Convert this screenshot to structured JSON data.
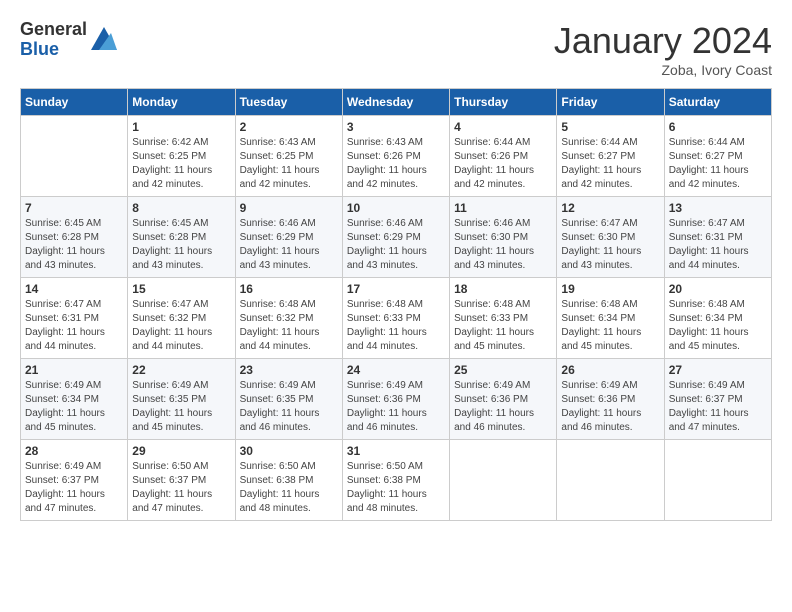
{
  "logo": {
    "general": "General",
    "blue": "Blue"
  },
  "title": "January 2024",
  "subtitle": "Zoba, Ivory Coast",
  "days_of_week": [
    "Sunday",
    "Monday",
    "Tuesday",
    "Wednesday",
    "Thursday",
    "Friday",
    "Saturday"
  ],
  "weeks": [
    [
      {
        "day": "",
        "info": ""
      },
      {
        "day": "1",
        "info": "Sunrise: 6:42 AM\nSunset: 6:25 PM\nDaylight: 11 hours\nand 42 minutes."
      },
      {
        "day": "2",
        "info": "Sunrise: 6:43 AM\nSunset: 6:25 PM\nDaylight: 11 hours\nand 42 minutes."
      },
      {
        "day": "3",
        "info": "Sunrise: 6:43 AM\nSunset: 6:26 PM\nDaylight: 11 hours\nand 42 minutes."
      },
      {
        "day": "4",
        "info": "Sunrise: 6:44 AM\nSunset: 6:26 PM\nDaylight: 11 hours\nand 42 minutes."
      },
      {
        "day": "5",
        "info": "Sunrise: 6:44 AM\nSunset: 6:27 PM\nDaylight: 11 hours\nand 42 minutes."
      },
      {
        "day": "6",
        "info": "Sunrise: 6:44 AM\nSunset: 6:27 PM\nDaylight: 11 hours\nand 42 minutes."
      }
    ],
    [
      {
        "day": "7",
        "info": "Sunrise: 6:45 AM\nSunset: 6:28 PM\nDaylight: 11 hours\nand 43 minutes."
      },
      {
        "day": "8",
        "info": "Sunrise: 6:45 AM\nSunset: 6:28 PM\nDaylight: 11 hours\nand 43 minutes."
      },
      {
        "day": "9",
        "info": "Sunrise: 6:46 AM\nSunset: 6:29 PM\nDaylight: 11 hours\nand 43 minutes."
      },
      {
        "day": "10",
        "info": "Sunrise: 6:46 AM\nSunset: 6:29 PM\nDaylight: 11 hours\nand 43 minutes."
      },
      {
        "day": "11",
        "info": "Sunrise: 6:46 AM\nSunset: 6:30 PM\nDaylight: 11 hours\nand 43 minutes."
      },
      {
        "day": "12",
        "info": "Sunrise: 6:47 AM\nSunset: 6:30 PM\nDaylight: 11 hours\nand 43 minutes."
      },
      {
        "day": "13",
        "info": "Sunrise: 6:47 AM\nSunset: 6:31 PM\nDaylight: 11 hours\nand 44 minutes."
      }
    ],
    [
      {
        "day": "14",
        "info": "Sunrise: 6:47 AM\nSunset: 6:31 PM\nDaylight: 11 hours\nand 44 minutes."
      },
      {
        "day": "15",
        "info": "Sunrise: 6:47 AM\nSunset: 6:32 PM\nDaylight: 11 hours\nand 44 minutes."
      },
      {
        "day": "16",
        "info": "Sunrise: 6:48 AM\nSunset: 6:32 PM\nDaylight: 11 hours\nand 44 minutes."
      },
      {
        "day": "17",
        "info": "Sunrise: 6:48 AM\nSunset: 6:33 PM\nDaylight: 11 hours\nand 44 minutes."
      },
      {
        "day": "18",
        "info": "Sunrise: 6:48 AM\nSunset: 6:33 PM\nDaylight: 11 hours\nand 45 minutes."
      },
      {
        "day": "19",
        "info": "Sunrise: 6:48 AM\nSunset: 6:34 PM\nDaylight: 11 hours\nand 45 minutes."
      },
      {
        "day": "20",
        "info": "Sunrise: 6:48 AM\nSunset: 6:34 PM\nDaylight: 11 hours\nand 45 minutes."
      }
    ],
    [
      {
        "day": "21",
        "info": "Sunrise: 6:49 AM\nSunset: 6:34 PM\nDaylight: 11 hours\nand 45 minutes."
      },
      {
        "day": "22",
        "info": "Sunrise: 6:49 AM\nSunset: 6:35 PM\nDaylight: 11 hours\nand 45 minutes."
      },
      {
        "day": "23",
        "info": "Sunrise: 6:49 AM\nSunset: 6:35 PM\nDaylight: 11 hours\nand 46 minutes."
      },
      {
        "day": "24",
        "info": "Sunrise: 6:49 AM\nSunset: 6:36 PM\nDaylight: 11 hours\nand 46 minutes."
      },
      {
        "day": "25",
        "info": "Sunrise: 6:49 AM\nSunset: 6:36 PM\nDaylight: 11 hours\nand 46 minutes."
      },
      {
        "day": "26",
        "info": "Sunrise: 6:49 AM\nSunset: 6:36 PM\nDaylight: 11 hours\nand 46 minutes."
      },
      {
        "day": "27",
        "info": "Sunrise: 6:49 AM\nSunset: 6:37 PM\nDaylight: 11 hours\nand 47 minutes."
      }
    ],
    [
      {
        "day": "28",
        "info": "Sunrise: 6:49 AM\nSunset: 6:37 PM\nDaylight: 11 hours\nand 47 minutes."
      },
      {
        "day": "29",
        "info": "Sunrise: 6:50 AM\nSunset: 6:37 PM\nDaylight: 11 hours\nand 47 minutes."
      },
      {
        "day": "30",
        "info": "Sunrise: 6:50 AM\nSunset: 6:38 PM\nDaylight: 11 hours\nand 48 minutes."
      },
      {
        "day": "31",
        "info": "Sunrise: 6:50 AM\nSunset: 6:38 PM\nDaylight: 11 hours\nand 48 minutes."
      },
      {
        "day": "",
        "info": ""
      },
      {
        "day": "",
        "info": ""
      },
      {
        "day": "",
        "info": ""
      }
    ]
  ]
}
